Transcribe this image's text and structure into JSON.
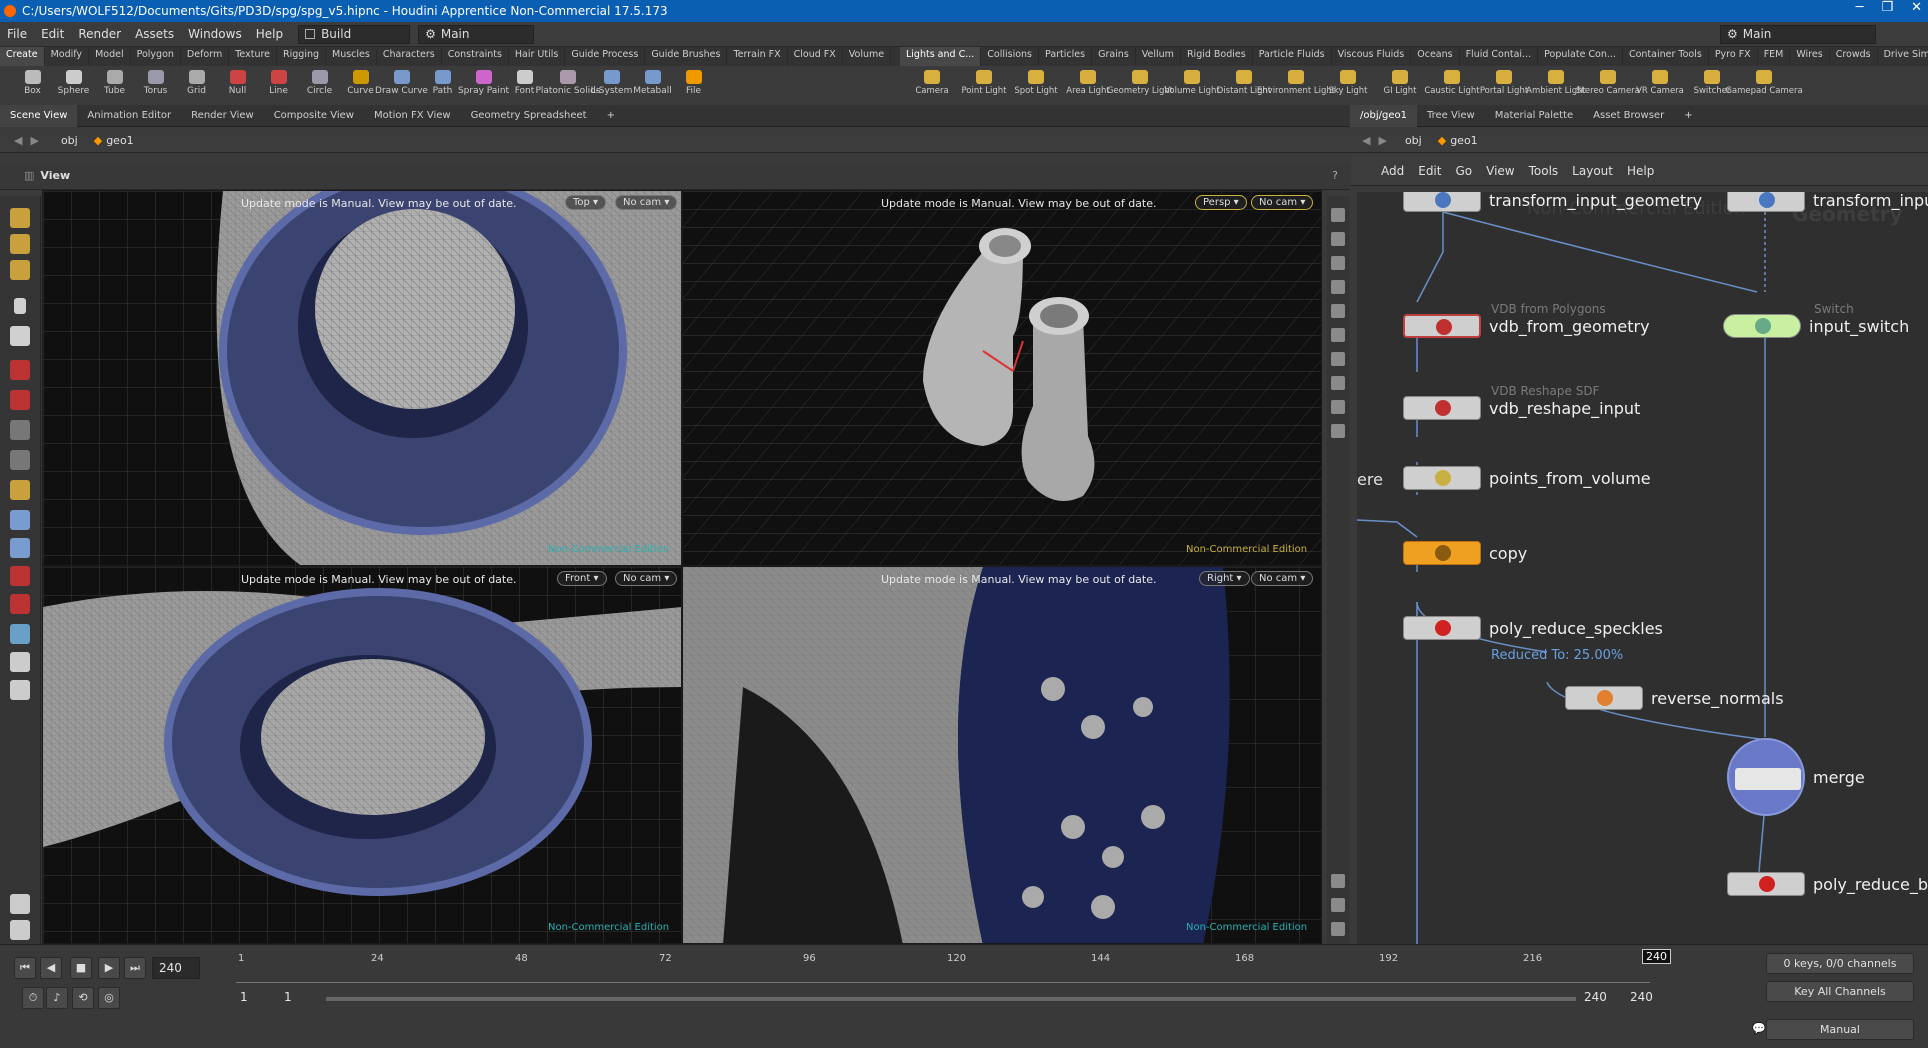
{
  "window": {
    "title": "C:/Users/WOLF512/Documents/Gits/PD3D/spg/spg_v5.hipnc - Houdini Apprentice Non-Commercial 17.5.173"
  },
  "menu": {
    "items": [
      "File",
      "Edit",
      "Render",
      "Assets",
      "Windows",
      "Help"
    ],
    "desktop": "Build",
    "context": "Main",
    "right_context": "Main"
  },
  "shelf_tabs_left": [
    "Create",
    "Modify",
    "Model",
    "Polygon",
    "Deform",
    "Texture",
    "Rigging",
    "Muscles",
    "Characters",
    "Constraints",
    "Hair Utils",
    "Guide Process",
    "Guide Brushes",
    "Terrain FX",
    "Cloud FX",
    "Volume"
  ],
  "shelf_tabs_right": [
    "Lights and C...",
    "Collisions",
    "Particles",
    "Grains",
    "Vellum",
    "Rigid Bodies",
    "Particle Fluids",
    "Viscous Fluids",
    "Oceans",
    "Fluid Contai...",
    "Populate Con...",
    "Container Tools",
    "Pyro FX",
    "FEM",
    "Wires",
    "Crowds",
    "Drive Simula..."
  ],
  "tools_left": [
    "Box",
    "Sphere",
    "Tube",
    "Torus",
    "Grid",
    "Null",
    "Line",
    "Circle",
    "Curve",
    "Draw Curve",
    "Path",
    "Spray Paint",
    "Font",
    "Platonic Solids",
    "L-System",
    "Metaball",
    "File"
  ],
  "tools_right": [
    "Camera",
    "Point Light",
    "Spot Light",
    "Area Light",
    "Geometry Light",
    "Volume Light",
    "Distant Light",
    "Environment Light",
    "Sky Light",
    "GI Light",
    "Caustic Light",
    "Portal Light",
    "Ambient Light",
    "Stereo Camera",
    "VR Camera",
    "Switcher",
    "Gamepad Camera"
  ],
  "pane_tabs_left": [
    "Scene View",
    "Animation Editor",
    "Render View",
    "Composite View",
    "Motion FX View",
    "Geometry Spreadsheet"
  ],
  "pane_tabs_right": [
    "/obj/geo1",
    "Tree View",
    "Material Palette",
    "Asset Browser"
  ],
  "path_left": {
    "obj": "obj",
    "geo": "geo1"
  },
  "path_right": {
    "obj": "obj",
    "geo": "geo1"
  },
  "view_label": "View",
  "viewports": {
    "message": "Update mode is Manual. View may be out of date.",
    "top": {
      "view": "Top",
      "cam": "No cam"
    },
    "persp": {
      "view": "Persp",
      "cam": "No cam"
    },
    "front": {
      "view": "Front",
      "cam": "No cam"
    },
    "right": {
      "view": "Right",
      "cam": "No cam"
    },
    "watermark": "Non-Commercial Edition"
  },
  "network_menu": [
    "Add",
    "Edit",
    "Go",
    "View",
    "Tools",
    "Layout",
    "Help"
  ],
  "network": {
    "watermark1": "Non-Commercial Edition",
    "watermark2": "Geometry",
    "nodes": {
      "transform_input_geometry": "transform_input_geometry",
      "transform_input_right": "transform_inpu",
      "vdb_from_geometry": {
        "type": "VDB from Polygons",
        "name": "vdb_from_geometry"
      },
      "input_switch": {
        "type": "Switch",
        "name": "input_switch"
      },
      "vdb_reshape_input": {
        "type": "VDB Reshape SDF",
        "name": "vdb_reshape_input"
      },
      "points_from_volume": "points_from_volume",
      "offscreen": "ere",
      "copy": "copy",
      "poly_reduce_speckles": "poly_reduce_speckles",
      "reduced_info": "Reduced To: 25.00%",
      "reverse_normals": "reverse_normals",
      "merge": "merge",
      "poly_reduce_b": "poly_reduce_b"
    }
  },
  "timeline": {
    "current_frame": "240",
    "ticks": [
      "1",
      "24",
      "48",
      "72",
      "96",
      "120",
      "144",
      "168",
      "192",
      "216"
    ],
    "marker": "240",
    "start": "1",
    "start2": "1",
    "end": "240",
    "end2": "240",
    "keys_info": "0 keys, 0/0 channels",
    "key_all": "Key All Channels",
    "update_mode": "Manual"
  }
}
